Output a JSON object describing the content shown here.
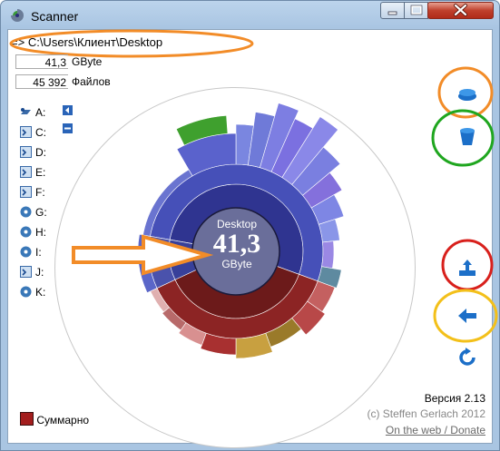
{
  "window": {
    "title": "Scanner"
  },
  "path": {
    "arrow": "=>",
    "value": "C:\\Users\\Клиент\\Desktop"
  },
  "stats": {
    "size_value": "41,3",
    "size_unit": "GByte",
    "files_value": "45 392",
    "files_label": "Файлов"
  },
  "drives": [
    {
      "label": "A:",
      "icon": "floppy-drive-icon"
    },
    {
      "label": "C:",
      "icon": "hard-drive-icon"
    },
    {
      "label": "D:",
      "icon": "hard-drive-icon"
    },
    {
      "label": "E:",
      "icon": "hard-drive-icon"
    },
    {
      "label": "F:",
      "icon": "hard-drive-icon"
    },
    {
      "label": "G:",
      "icon": "cd-drive-icon"
    },
    {
      "label": "H:",
      "icon": "cd-drive-icon"
    },
    {
      "label": "I:",
      "icon": "cd-drive-icon"
    },
    {
      "label": "J:",
      "icon": "hard-drive-icon"
    },
    {
      "label": "K:",
      "icon": "cd-drive-icon"
    }
  ],
  "center": {
    "folder": "Desktop",
    "size": "41,3",
    "unit": "GByte"
  },
  "footer": {
    "version": "Версия 2.13",
    "copyright": "(c) Steffen Gerlach 2012",
    "web_link": "On the web / Donate",
    "summary_label": "Суммарно"
  },
  "colors": {
    "highlight_orange": "#f28c28",
    "highlight_green": "#1fa61f",
    "highlight_red": "#d8201c",
    "highlight_yellow": "#f3c01a",
    "ring_center": "#6a6e9a",
    "summary_swatch": "#a31d1d"
  }
}
